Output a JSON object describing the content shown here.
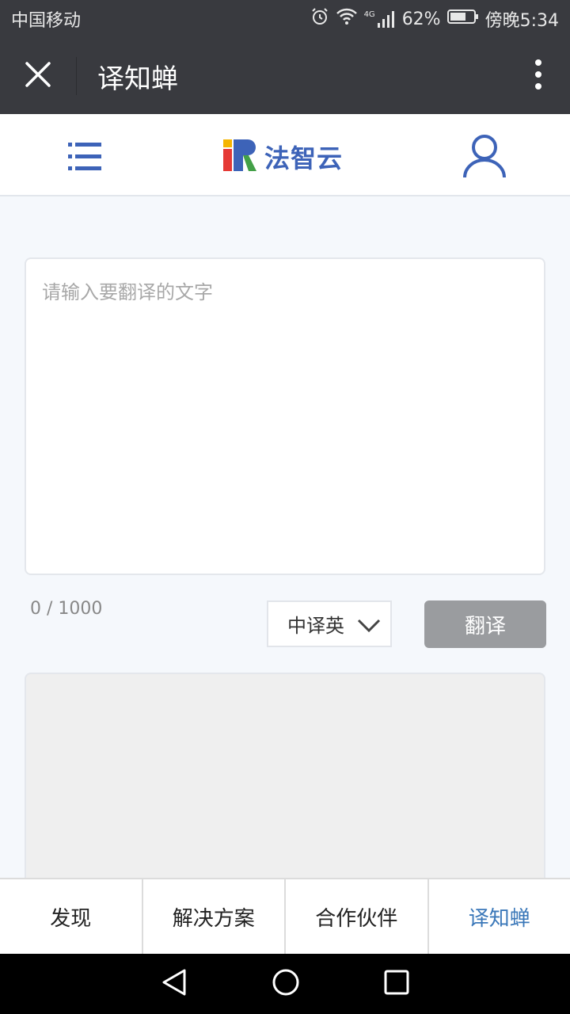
{
  "status_bar": {
    "carrier": "中国移动",
    "network": "4G",
    "battery": "62%",
    "time": "傍晚5:34"
  },
  "titlebar": {
    "title": "译知蝉"
  },
  "header": {
    "logo_text": "法智云"
  },
  "translator": {
    "placeholder": "请输入要翻译的文字",
    "char_count": "0 / 1000",
    "language": "中译英",
    "translate_label": "翻译"
  },
  "tabs": [
    {
      "label": "发现"
    },
    {
      "label": "解决方案"
    },
    {
      "label": "合作伙伴"
    },
    {
      "label": "译知蝉"
    }
  ],
  "colors": {
    "titlebar_bg": "#393a3f",
    "brand_blue": "#3d63b8",
    "active_tab": "#3b78b9",
    "button_disabled": "#9a9c9f"
  }
}
